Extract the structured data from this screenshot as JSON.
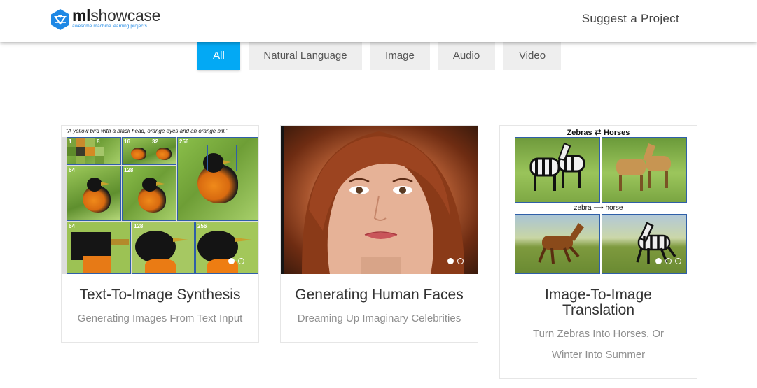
{
  "brand": {
    "bold": "ml",
    "rest": "showcase",
    "tagline": "awesome machine learning projects"
  },
  "nav": {
    "suggest_label": "Suggest a Project"
  },
  "filters": [
    {
      "label": "All",
      "active": true
    },
    {
      "label": "Natural Language",
      "active": false
    },
    {
      "label": "Image",
      "active": false
    },
    {
      "label": "Audio",
      "active": false
    },
    {
      "label": "Video",
      "active": false
    }
  ],
  "cards": [
    {
      "title": "Text-To-Image Synthesis",
      "subtitle": "Generating Images From Text Input",
      "image": {
        "caption": "\"A yellow bird with a black head, orange eyes and an orange bill.\"",
        "stages": [
          "1",
          "8",
          "16",
          "32",
          "256",
          "64",
          "128",
          "64",
          "128",
          "256"
        ]
      },
      "slides": 2,
      "active_slide": 0
    },
    {
      "title": "Generating Human Faces",
      "subtitle": "Dreaming Up Imaginary Celebrities",
      "slides": 2,
      "active_slide": 0
    },
    {
      "title": "Image-To-Image Translation",
      "subtitle": "Turn Zebras Into Horses, Or Winter Into Summer",
      "image": {
        "top_label_left": "Zebras",
        "top_label_right": "Horses",
        "mid_label_left": "zebra",
        "mid_label_right": "horse"
      },
      "slides": 3,
      "active_slide": 0
    }
  ],
  "colors": {
    "accent": "#03a9f4",
    "brand_blue": "#1e88e5",
    "filter_bg": "#eeeeee"
  }
}
